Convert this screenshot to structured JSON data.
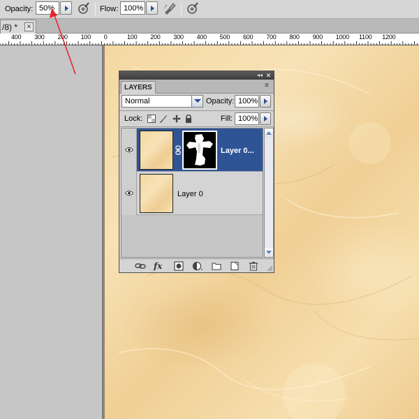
{
  "options_bar": {
    "opacity_label": "Opacity:",
    "opacity_value": "50%",
    "flow_label": "Flow:",
    "flow_value": "100%",
    "airbrush_icon": "airbrush-icon",
    "tablet_pressure_icon": "tablet-pressure-icon"
  },
  "document_tab": {
    "title": "/8) *",
    "close_glyph": "✕"
  },
  "ruler": {
    "ticks": [
      "400",
      "300",
      "200",
      "100",
      "0",
      "100",
      "200",
      "300",
      "400",
      "500",
      "600",
      "700",
      "800",
      "900",
      "1000",
      "1100",
      "1200"
    ]
  },
  "layers_panel": {
    "collapse_glyph": "◂◂",
    "close_glyph": "✕",
    "tab_label": "LAYERS",
    "menu_glyph": "≡",
    "blend_mode": "Normal",
    "opacity_label": "Opacity:",
    "opacity_value": "100%",
    "lock_label": "Lock:",
    "fill_label": "Fill:",
    "fill_value": "100%",
    "layers": [
      {
        "name": "Layer 0...",
        "selected": true,
        "has_mask": true,
        "visible": true
      },
      {
        "name": "Layer 0",
        "selected": false,
        "has_mask": false,
        "visible": true
      }
    ],
    "footer_icons": [
      "link-layers-icon",
      "fx-icon",
      "add-mask-icon",
      "adjustment-layer-icon",
      "new-group-icon",
      "new-layer-icon",
      "delete-layer-icon"
    ],
    "fx_label": "fx"
  },
  "annotation": {
    "color": "#e8252b"
  },
  "colors": {
    "selected_layer": "#2f5496",
    "parchment": "#f4d8a2"
  }
}
